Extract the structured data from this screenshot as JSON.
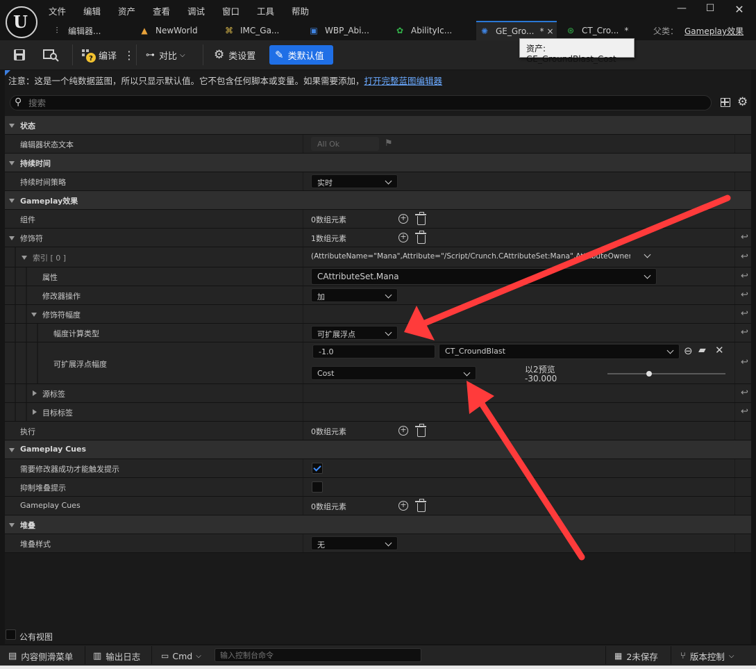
{
  "menu": [
    "文件",
    "编辑",
    "资产",
    "查看",
    "调试",
    "窗口",
    "工具",
    "帮助"
  ],
  "tabs": [
    {
      "label": "编辑器...",
      "icon": "sliders-icon",
      "icon_color": "#cfcfcf"
    },
    {
      "label": "NewWorld",
      "icon": "level-icon",
      "icon_color": "#e8a23a"
    },
    {
      "label": "IMC_Ga...",
      "icon": "input-mapping-icon",
      "icon_color": "#d9b84a"
    },
    {
      "label": "WBP_Abi...",
      "icon": "widget-icon",
      "icon_color": "#3f83e0"
    },
    {
      "label": "AbilityIc...",
      "icon": "ability-icon",
      "icon_color": "#33b24a"
    },
    {
      "label": "GE_Gro...",
      "icon": "gameplay-effect-icon",
      "icon_color": "#3f83e0",
      "active": true
    },
    {
      "label": "CT_Cro...",
      "icon": "curve-table-icon",
      "icon_color": "#33b24a"
    }
  ],
  "tab_modified": "*",
  "tab_close": "×",
  "parent_class_label": "父类：",
  "parent_class_value": "Gameplay效果",
  "tooltip": "资产: GE_GroundBlast_Cost",
  "toolbar": {
    "compile": "编译",
    "diff": "对比",
    "class_settings": "类设置",
    "class_defaults": "类默认值"
  },
  "notice": {
    "text": "注意：这是一个纯数据蓝图，所以只显示默认值。它不包含任何脚本或变量。如果需要添加，",
    "link": "打开完整蓝图编辑器"
  },
  "search": {
    "placeholder": "搜索"
  },
  "sections": {
    "status": "状态",
    "editor_status_text": "编辑器状态文本",
    "editor_status_value": "All Ok",
    "duration": "持续时间",
    "duration_policy": "持续时间策略",
    "duration_policy_value": "实时",
    "gameplay_effect": "Gameplay效果",
    "components": "组件",
    "components_value": "0数组元素",
    "modifiers": "修饰符",
    "modifiers_value": "1数组元素",
    "index0": "索引 [ 0 ]",
    "index0_value": "(AttributeName=\"Mana\",Attribute=\"/Script/Crunch.CAttributeSet:Mana\",AttributeOwner=\"/Sc",
    "attribute": "属性",
    "attribute_value": "CAttributeSet.Mana",
    "modifier_op": "修改器操作",
    "modifier_op_value": "加",
    "modifier_magnitude": "修饰符幅度",
    "magnitude_calc_type": "幅度计算类型",
    "magnitude_calc_type_value": "可扩展浮点",
    "scalable_float_magnitude": "可扩展浮点幅度",
    "scalable_value": "-1.0",
    "curve_table": "CT_CroundBlast",
    "curve_row": "Cost",
    "preview_label": "以2预览",
    "preview_value": "-30.000",
    "preview_level": 0.35,
    "source_tags": "源标签",
    "target_tags": "目标标签",
    "executions": "执行",
    "executions_value": "0数组元素",
    "gameplay_cues": "Gameplay Cues",
    "require_modifier_success": "需要修改器成功才能触发提示",
    "require_modifier_success_value": true,
    "suppress_stacking_cues": "抑制堆叠提示",
    "suppress_stacking_cues_value": false,
    "gameplay_cues_prop": "Gameplay Cues",
    "gameplay_cues_value": "0数组元素",
    "stacking": "堆叠",
    "stacking_type": "堆叠样式",
    "stacking_type_value": "无"
  },
  "public_view": "公有视图",
  "statusbar": {
    "content_drawer": "内容侧滑菜单",
    "output_log": "输出日志",
    "cmd": "Cmd",
    "cmd_placeholder": "输入控制台命令",
    "unsaved": "2未保存",
    "source_control": "版本控制"
  },
  "colors": {
    "accent": "#1f6fe6",
    "arrow": "#ff3b3b",
    "link": "#6aa9ff"
  }
}
